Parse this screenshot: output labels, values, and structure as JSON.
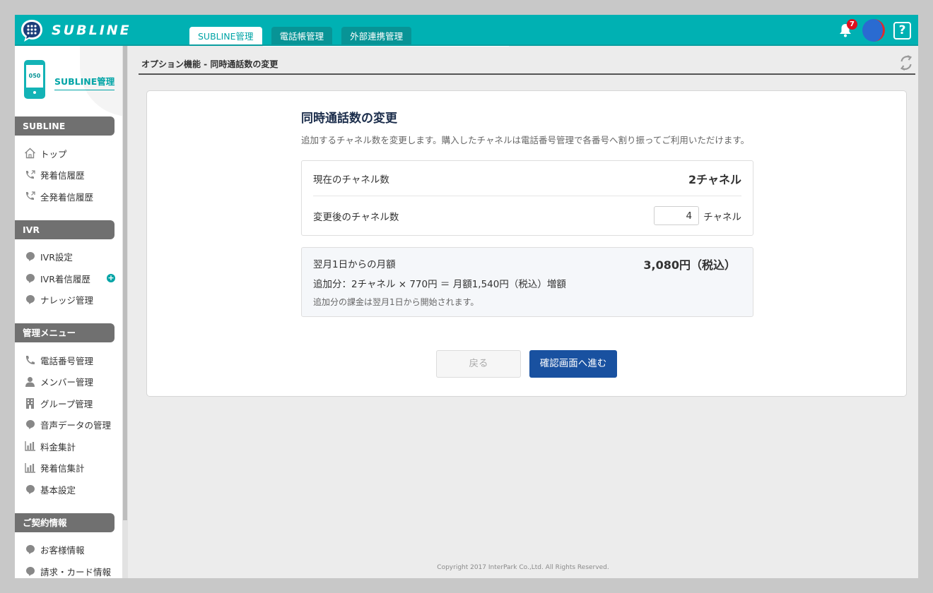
{
  "header": {
    "brand": "SUBLINE",
    "tabs": [
      {
        "label": "SUBLINE管理",
        "active": true
      },
      {
        "label": "電話帳管理",
        "active": false
      },
      {
        "label": "外部連携管理",
        "active": false
      }
    ],
    "notification_count": "7",
    "help_label": "?"
  },
  "sidebar": {
    "title": "SUBLINE管理",
    "phone_label": "050",
    "sections": [
      {
        "title": "SUBLINE",
        "items": [
          "トップ",
          "発着信履歴",
          "全発着信履歴"
        ]
      },
      {
        "title": "IVR",
        "items": [
          "IVR設定",
          "IVR着信履歴",
          "ナレッジ管理"
        ]
      },
      {
        "title": "管理メニュー",
        "items": [
          "電話番号管理",
          "メンバー管理",
          "グループ管理",
          "音声データの管理",
          "料金集計",
          "発着信集計",
          "基本設定"
        ]
      },
      {
        "title": "ご契約情報",
        "items": [
          "お客様情報",
          "請求・カード情報"
        ]
      }
    ]
  },
  "breadcrumb": "オプション機能 - 同時通話数の変更",
  "main": {
    "title": "同時通話数の変更",
    "description": "追加するチャネル数を変更します。購入したチャネルは電話番号管理で各番号へ割り振ってご利用いただけます。",
    "current_label": "現在のチャネル数",
    "current_value": "2チャネル",
    "new_label": "変更後のチャネル数",
    "new_value": "4",
    "new_unit": "チャネル",
    "monthly_label": "翌月1日からの月額",
    "monthly_price": "3,080円（税込）",
    "addition_line": "追加分：2チャネル × 770円 ＝ 月額1,540円（税込）増額",
    "note": "追加分の課金は翌月1日から開始されます。",
    "back_button": "戻る",
    "next_button": "確認画面へ進む"
  },
  "footer": {
    "copyright": "Copyright 2017 InterPark Co.,Ltd. All Rights Reserved."
  },
  "colors": {
    "brand_teal": "#00b1b3",
    "primary_button": "#1951a0",
    "section_header": "#707070"
  }
}
